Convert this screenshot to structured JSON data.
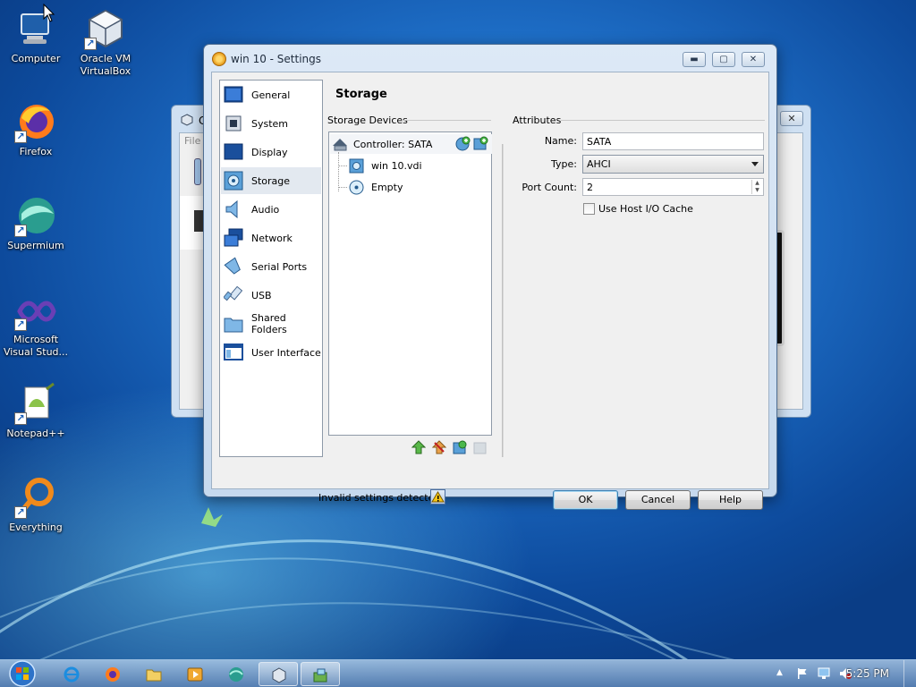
{
  "desktop": {
    "icons": [
      {
        "label": "Computer"
      },
      {
        "label": "Oracle VM VirtualBox"
      },
      {
        "label": "Firefox"
      },
      {
        "label": "Supermium"
      },
      {
        "label": "Microsoft Visual Stud..."
      },
      {
        "label": "Notepad++"
      },
      {
        "label": "Everything"
      }
    ]
  },
  "bg_window": {
    "title": "C",
    "menu": "File"
  },
  "dialog": {
    "title": "win 10 - Settings",
    "section_title": "Storage",
    "nav": [
      {
        "label": "General"
      },
      {
        "label": "System"
      },
      {
        "label": "Display"
      },
      {
        "label": "Storage"
      },
      {
        "label": "Audio"
      },
      {
        "label": "Network"
      },
      {
        "label": "Serial Ports"
      },
      {
        "label": "USB"
      },
      {
        "label": "Shared Folders"
      },
      {
        "label": "User Interface"
      }
    ],
    "storage_devices_label": "Storage Devices",
    "tree": {
      "controller": "Controller: SATA",
      "disk": "win 10.vdi",
      "optical": "Empty"
    },
    "attributes_label": "Attributes",
    "attributes": {
      "name_label": "Name:",
      "name_value": "SATA",
      "type_label": "Type:",
      "type_value": "AHCI",
      "port_label": "Port Count:",
      "port_value": "2",
      "cache_label": "Use Host I/O Cache",
      "cache_checked": false
    },
    "warning": "Invalid settings detected",
    "buttons": {
      "ok": "OK",
      "cancel": "Cancel",
      "help": "Help"
    }
  },
  "taskbar": {
    "clock": "5:25 PM"
  },
  "colors": {
    "accent": "#3c7fb1",
    "selection": "#e3e9f0"
  }
}
